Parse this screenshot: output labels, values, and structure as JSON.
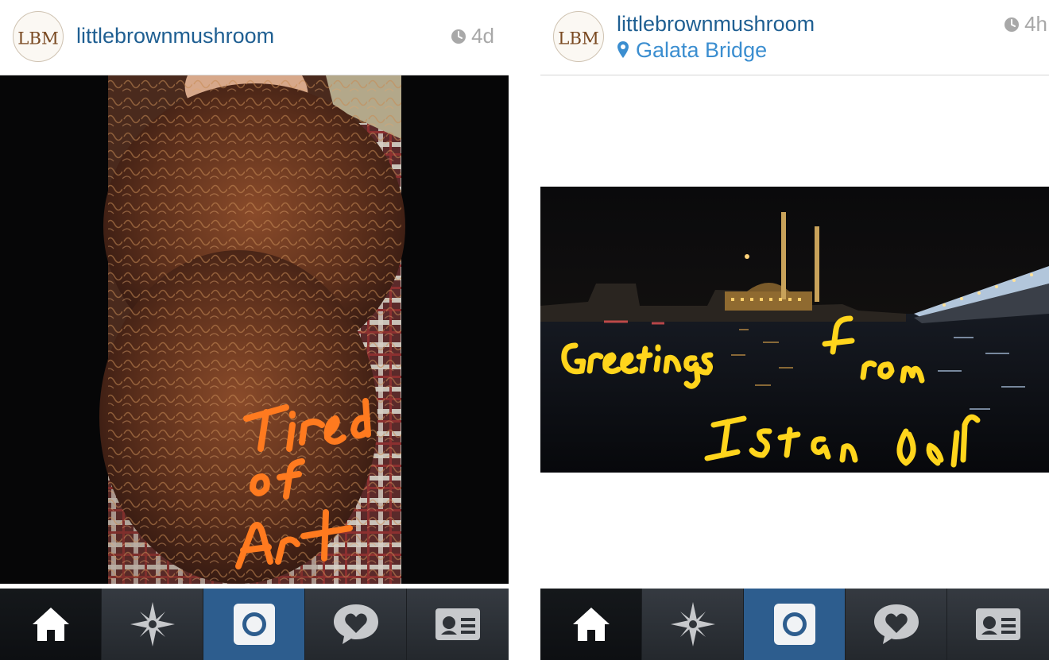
{
  "screens": [
    {
      "username": "littlebrownmushroom",
      "time": "4d",
      "location": "",
      "avatar_monogram": "LBM",
      "photo_caption_lines": [
        "Tired",
        "of",
        "Art"
      ],
      "caption_color": "#ff7a1f",
      "tabs": [
        "home-icon",
        "explore-icon",
        "camera-icon",
        "activity-icon",
        "profile-icon"
      ]
    },
    {
      "username": "littlebrownmushroom",
      "time": "4h",
      "location": "Galata Bridge",
      "avatar_monogram": "LBM",
      "photo_caption_lines": [
        "Greetings from",
        "Istanbul"
      ],
      "caption_color": "#ffd51c",
      "tabs": [
        "home-icon",
        "explore-icon",
        "camera-icon",
        "activity-icon",
        "profile-icon"
      ]
    }
  ],
  "colors": {
    "username": "#1f5f92",
    "location": "#3b8ed0",
    "timestamp": "#a8a8a8",
    "tab_active": "#2d5d8e",
    "tabbar": "#2b2f35"
  }
}
